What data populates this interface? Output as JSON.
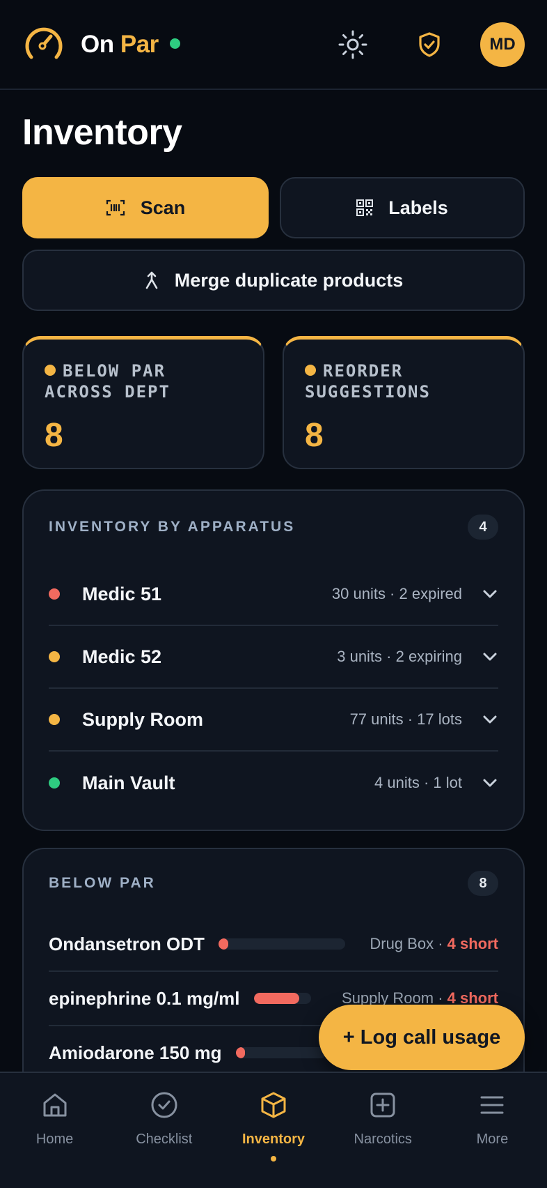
{
  "header": {
    "brand_on": "On",
    "brand_par": "Par",
    "avatar_initials": "MD",
    "icons": [
      "gauge-logo-icon",
      "sun-icon",
      "shield-check-icon"
    ]
  },
  "page": {
    "title": "Inventory"
  },
  "actions": {
    "scan_label": "Scan",
    "labels_label": "Labels",
    "merge_label": "Merge duplicate products"
  },
  "stats": [
    {
      "label": "BELOW PAR ACROSS DEPT",
      "value": "8"
    },
    {
      "label": "REORDER SUGGESTIONS",
      "value": "8"
    }
  ],
  "apparatus": {
    "title": "INVENTORY BY APPARATUS",
    "count": "4",
    "items": [
      {
        "name": "Medic 51",
        "meta": "30 units · 2 expired",
        "status_color": "#f26a5f"
      },
      {
        "name": "Medic 52",
        "meta": "3 units · 2 expiring",
        "status_color": "#f4b544"
      },
      {
        "name": "Supply Room",
        "meta": "77 units · 17 lots",
        "status_color": "#f4b544"
      },
      {
        "name": "Main Vault",
        "meta": "4 units · 1 lot",
        "status_color": "#2ecc80"
      }
    ]
  },
  "below_par": {
    "title": "BELOW PAR",
    "count": "8",
    "items": [
      {
        "name": "Ondansetron ODT",
        "location": "Drug Box · ",
        "short": "4 short",
        "fill": 0.08
      },
      {
        "name": "epinephrine 0.1 mg/ml",
        "location": "Supply Room · ",
        "short": "4 short",
        "fill": 0.8
      },
      {
        "name": "Amiodarone 150 mg",
        "location": "",
        "short": "",
        "fill": 0.1
      }
    ]
  },
  "fab": {
    "label": "+ Log call usage"
  },
  "nav": {
    "items": [
      {
        "label": "Home",
        "icon": "home-icon"
      },
      {
        "label": "Checklist",
        "icon": "check-circle-icon"
      },
      {
        "label": "Inventory",
        "icon": "box-icon",
        "active": true
      },
      {
        "label": "Narcotics",
        "icon": "plus-square-icon"
      },
      {
        "label": "More",
        "icon": "menu-icon"
      }
    ]
  },
  "colors": {
    "accent": "#f4b544",
    "danger": "#f26a5f",
    "ok": "#2ecc80",
    "background": "#070b12"
  }
}
